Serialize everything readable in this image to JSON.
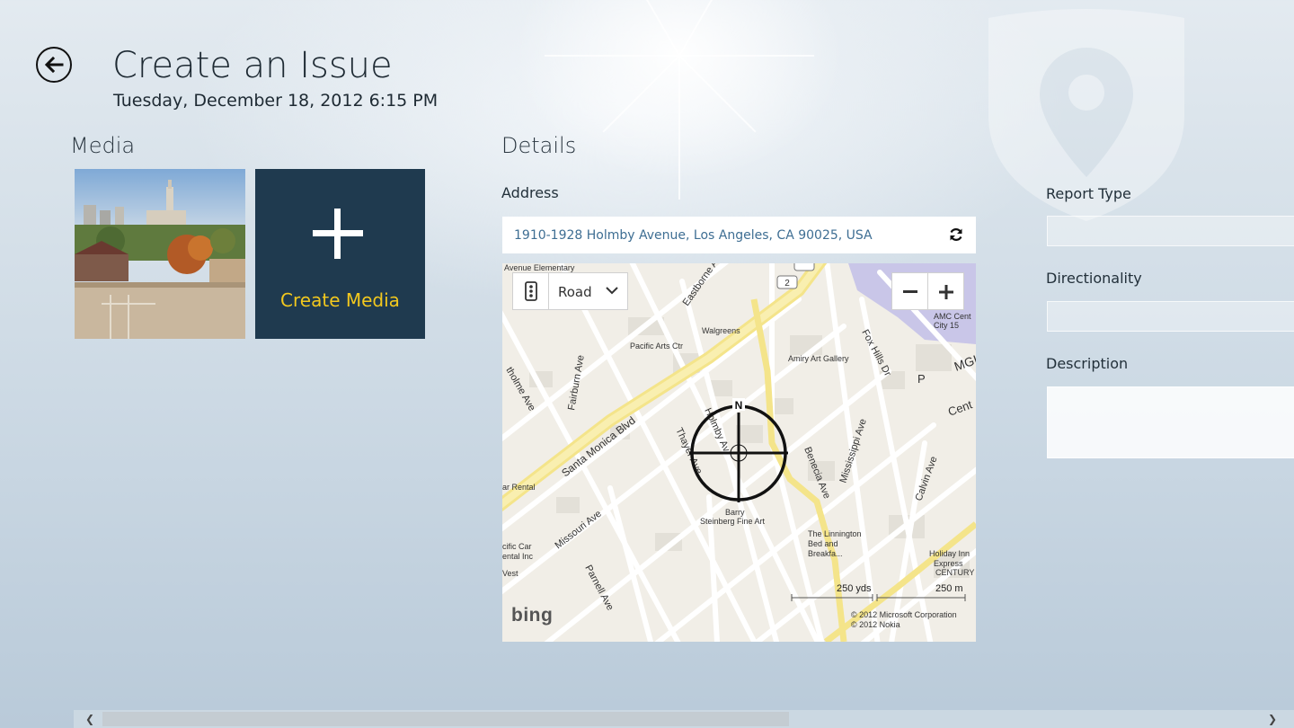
{
  "header": {
    "title": "Create an Issue",
    "subtitle": "Tuesday, December 18, 2012 6:15 PM"
  },
  "media": {
    "section_title": "Media",
    "create_label": "Create Media"
  },
  "details": {
    "section_title": "Details",
    "address_label": "Address",
    "address_value": "1910-1928 Holmby Avenue, Los Angeles, CA 90025, USA",
    "map": {
      "map_style": "Road",
      "compass": "N",
      "scale_imperial": "250 yds",
      "scale_metric": "250 m",
      "copyright_1": "© 2012 Microsoft Corporation",
      "copyright_2": "© 2012 Nokia",
      "logo": "bing",
      "labels": {
        "avenue_elementary": "Avenue Elementary",
        "eastborne": "Eastborne Av",
        "walgreens": "Walgreens",
        "pacific_arts": "Pacific Arts Ctr",
        "amiry": "Amiry Art Gallery",
        "fairburn": "Fairburn Ave",
        "holmby": "Holmby Av",
        "thayer": "Thayer Ave",
        "santa_monica": "Santa Monica Blvd",
        "beloit": "tholme Ave",
        "barry": "Barry",
        "barry2": "Steinberg Fine Art",
        "missouri": "Missouri Ave",
        "parnell": "Parnell Ave",
        "benecia": "Benecia Ave",
        "mississippi": "Mississippi Ave",
        "calvin": "Calvin Ave",
        "foxhills": "Fox Hills Dr",
        "linnington": "The Linnington",
        "linnington2": "Bed and",
        "linnington3": "Breakfa...",
        "holiday": "Holiday Inn",
        "holiday2": "Express",
        "century": "CENTURY CI",
        "amc": "AMC Cent",
        "amc2": "City 15",
        "car_rental": "ar Rental",
        "pacific_car": "cific Car",
        "pacific_car2": "ental Inc",
        "west": "Vest",
        "cent": "Cent",
        "mgm": "MGI",
        "p": "P",
        "route": "2"
      }
    }
  },
  "form": {
    "report_type_label": "Report Type",
    "directionality_label": "Directionality",
    "description_label": "Description"
  },
  "icons": {
    "back": "back-arrow-icon",
    "add": "plus-icon",
    "refresh": "refresh-icon",
    "traffic": "traffic-light-icon",
    "dropdown": "chevron-down-icon",
    "zoom_out": "minus-icon",
    "zoom_in": "plus-icon",
    "crosshair": "crosshair-icon",
    "watermark": "map-pin-shield-icon"
  },
  "scrollbar": {
    "left_arrow": "❮",
    "right_arrow": "❯"
  },
  "colors": {
    "tile_bg": "#1f3a4f",
    "tile_text": "#f2c81e",
    "address_text": "#3e6e93"
  }
}
